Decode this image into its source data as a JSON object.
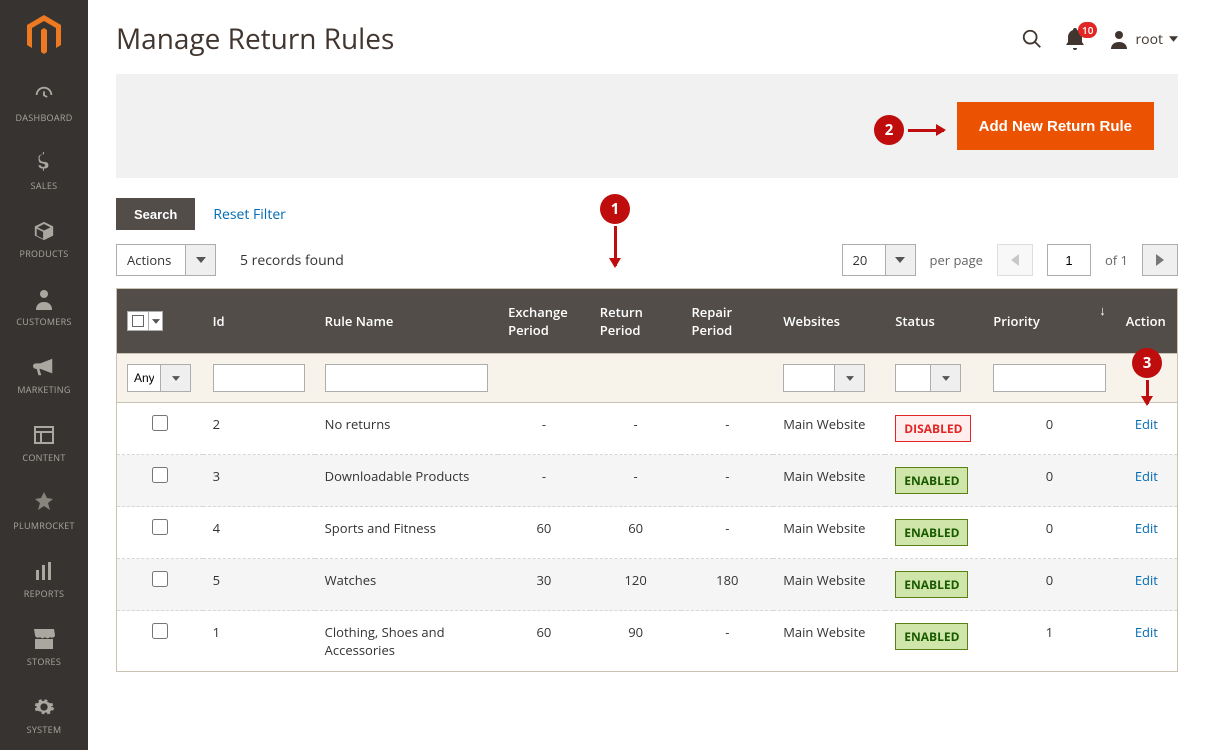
{
  "sidebar": {
    "items": [
      {
        "label": "DASHBOARD",
        "icon": "dashboard"
      },
      {
        "label": "SALES",
        "icon": "dollar"
      },
      {
        "label": "PRODUCTS",
        "icon": "box"
      },
      {
        "label": "CUSTOMERS",
        "icon": "user"
      },
      {
        "label": "MARKETING",
        "icon": "megaphone"
      },
      {
        "label": "CONTENT",
        "icon": "layout"
      },
      {
        "label": "PLUMROCKET",
        "icon": "plumrocket"
      },
      {
        "label": "REPORTS",
        "icon": "chart"
      },
      {
        "label": "STORES",
        "icon": "store"
      },
      {
        "label": "SYSTEM",
        "icon": "gear"
      }
    ]
  },
  "header": {
    "title": "Manage Return Rules",
    "notifications": "10",
    "user": "root"
  },
  "hero": {
    "primary_button": "Add New Return Rule"
  },
  "toolbar": {
    "search": "Search",
    "reset": "Reset Filter"
  },
  "controls": {
    "actions": "Actions",
    "records": "5 records found",
    "page_size": "20",
    "per_page": "per page",
    "current_page": "1",
    "total_pages": "of 1"
  },
  "columns": {
    "id": "Id",
    "rule_name": "Rule Name",
    "exchange": "Exchange Period",
    "return": "Return Period",
    "repair": "Repair Period",
    "websites": "Websites",
    "status": "Status",
    "priority": "Priority",
    "action": "Action"
  },
  "filters": {
    "any": "Any"
  },
  "rows": [
    {
      "id": "2",
      "name": "No returns",
      "exchange": "-",
      "return": "-",
      "repair": "-",
      "website": "Main Website",
      "status": "DISABLED",
      "status_class": "status-disabled",
      "priority": "0",
      "action": "Edit"
    },
    {
      "id": "3",
      "name": "Downloadable Products",
      "exchange": "-",
      "return": "-",
      "repair": "-",
      "website": "Main Website",
      "status": "ENABLED",
      "status_class": "status-enabled",
      "priority": "0",
      "action": "Edit"
    },
    {
      "id": "4",
      "name": "Sports and Fitness",
      "exchange": "60",
      "return": "60",
      "repair": "-",
      "website": "Main Website",
      "status": "ENABLED",
      "status_class": "status-enabled",
      "priority": "0",
      "action": "Edit"
    },
    {
      "id": "5",
      "name": "Watches",
      "exchange": "30",
      "return": "120",
      "repair": "180",
      "website": "Main Website",
      "status": "ENABLED",
      "status_class": "status-enabled",
      "priority": "0",
      "action": "Edit"
    },
    {
      "id": "1",
      "name": "Clothing, Shoes and Accessories",
      "exchange": "60",
      "return": "90",
      "repair": "-",
      "website": "Main Website",
      "status": "ENABLED",
      "status_class": "status-enabled",
      "priority": "1",
      "action": "Edit"
    }
  ],
  "annotations": {
    "a1": "1",
    "a2": "2",
    "a3": "3"
  }
}
